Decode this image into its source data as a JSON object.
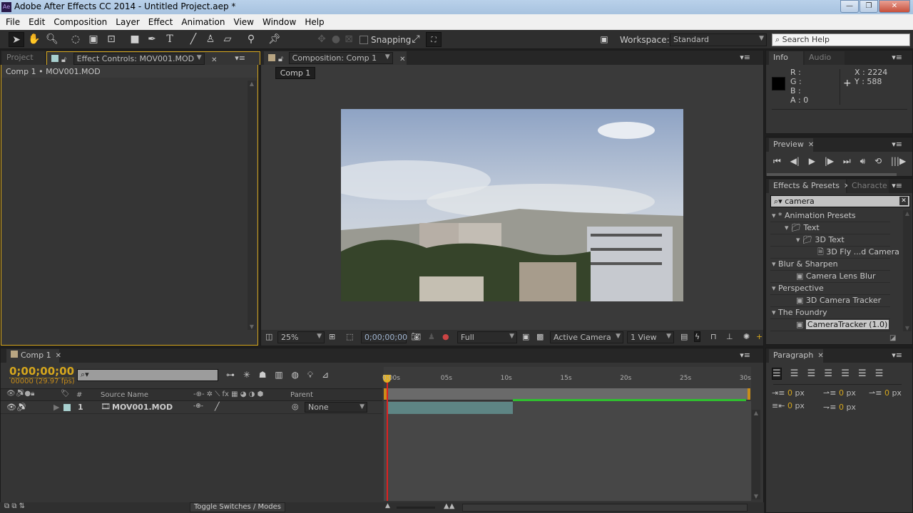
{
  "window": {
    "title": "Adobe After Effects CC 2014 - Untitled Project.aep *",
    "app_icon": "Ae"
  },
  "menu": [
    "File",
    "Edit",
    "Composition",
    "Layer",
    "Effect",
    "Animation",
    "View",
    "Window",
    "Help"
  ],
  "toolbar": {
    "snapping_label": "Snapping",
    "workspace_label": "Workspace:",
    "workspace_value": "Standard",
    "search_placeholder": "Search Help"
  },
  "left_panel": {
    "tabs": [
      "Project",
      "Effect Controls: MOV001.MOD"
    ],
    "breadcrumb": "Comp 1 • MOV001.MOD"
  },
  "comp_panel": {
    "tab": "Composition: Comp 1",
    "comp_button": "Comp 1",
    "zoom": "25%",
    "timecode": "0;00;00;00",
    "resolution": "Full",
    "camera": "Active Camera",
    "views": "1 View"
  },
  "info": {
    "tabs": [
      "Info",
      "Audio"
    ],
    "r": "R :",
    "g": "G :",
    "b": "B :",
    "a": "A : 0",
    "x": "X : 2224",
    "y": "Y : 588",
    "swatch_color": "#000000"
  },
  "preview": {
    "tab": "Preview"
  },
  "effects": {
    "tabs": [
      "Effects & Presets",
      "Characte"
    ],
    "search_value": "camera",
    "items": [
      {
        "label": "* Animation Presets",
        "level": 0,
        "type": "category"
      },
      {
        "label": "Text",
        "level": 1,
        "type": "folder"
      },
      {
        "label": "3D Text",
        "level": 2,
        "type": "folder"
      },
      {
        "label": "3D Fly ...d Camera",
        "level": 3,
        "type": "preset"
      },
      {
        "label": "Blur & Sharpen",
        "level": 0,
        "type": "category"
      },
      {
        "label": "Camera Lens Blur",
        "level": 2,
        "type": "effect"
      },
      {
        "label": "Perspective",
        "level": 0,
        "type": "category"
      },
      {
        "label": "3D Camera Tracker",
        "level": 2,
        "type": "effect"
      },
      {
        "label": "The Foundry",
        "level": 0,
        "type": "category"
      },
      {
        "label": "CameraTracker (1.0)",
        "level": 2,
        "type": "effect",
        "selected": true
      }
    ]
  },
  "paragraph": {
    "tab": "Paragraph",
    "values": [
      "0",
      "0",
      "0",
      "0",
      "0"
    ],
    "unit": "px"
  },
  "timeline": {
    "tab": "Comp 1",
    "timecode": "0;00;00;00",
    "frame_info": "00000 (29.97 fps)",
    "columns": {
      "num": "#",
      "source": "Source Name",
      "parent": "Parent"
    },
    "layers": [
      {
        "index": "1",
        "name": "MOV001.MOD",
        "parent": "None",
        "label_color": "#a8d0cf"
      }
    ],
    "ruler": [
      "0:00s",
      "05s",
      "10s",
      "15s",
      "20s",
      "25s",
      "30s"
    ],
    "toggle_label": "Toggle Switches / Modes"
  },
  "colors": {
    "accent": "#d6a71d",
    "playhead": "#e02020",
    "layer_bar": "#5e8584"
  }
}
